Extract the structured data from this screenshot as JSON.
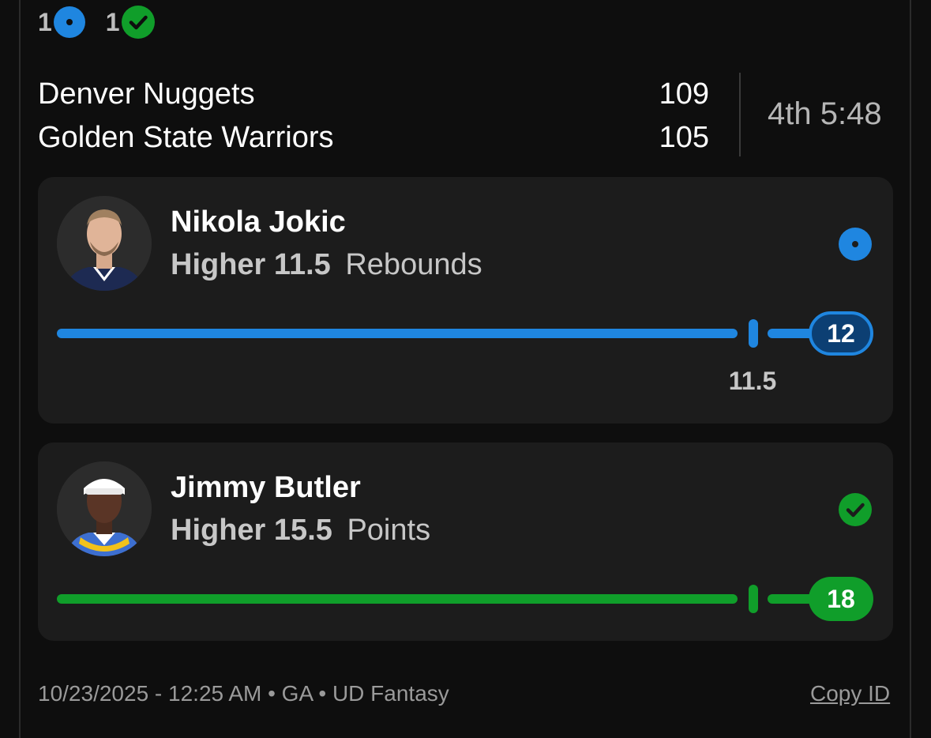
{
  "summary": {
    "live_count": "1",
    "won_count": "1"
  },
  "game": {
    "home_team": "Denver Nuggets",
    "home_score": "109",
    "away_team": "Golden State Warriors",
    "away_score": "105",
    "clock": "4th 5:48"
  },
  "picks": [
    {
      "player": "Nikola Jokic",
      "direction": "Higher",
      "line": "11.5",
      "stat": "Rebounds",
      "current": "12",
      "line_marker": "11.5",
      "status": "live",
      "status_icon": "dot-icon",
      "color": "#1f86e0",
      "line_fraction": 0.92
    },
    {
      "player": "Jimmy Butler",
      "direction": "Higher",
      "line": "15.5",
      "stat": "Points",
      "current": "18",
      "status": "won",
      "status_icon": "check-icon",
      "color": "#109e2a",
      "line_fraction": 0.92
    }
  ],
  "footer": {
    "meta": "10/23/2025 - 12:25 AM • GA • UD Fantasy",
    "copy_id": "Copy ID"
  }
}
